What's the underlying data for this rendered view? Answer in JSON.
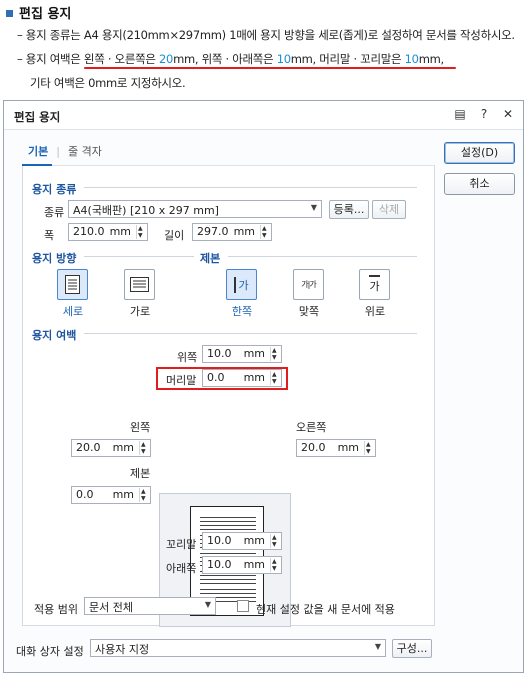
{
  "instructions": {
    "title": "편집 용지",
    "line1": "– 용지 종류는 A4 용지(210mm×297mm) 1매에 용지 방향을 세로(좁게)로 설정하여 문서를 작성하시오.",
    "line2_a": "– 용지 여백은 ",
    "line2_b": "왼쪽 · 오른쪽은 ",
    "line2_c": "20",
    "line2_d": "mm, 위쪽 · 아래쪽은 ",
    "line2_e": "10",
    "line2_f": "mm, 머리말 · 꼬리말은 ",
    "line2_g": "10",
    "line2_h": "mm,",
    "line3": "기타 여백은 0mm로 지정하시오."
  },
  "dialog": {
    "title": "편집 용지",
    "icons": [
      "help-doc-icon",
      "question-icon",
      "close-icon"
    ],
    "tabs": [
      "기본",
      "줄 격자"
    ],
    "buttons": {
      "ok": "설정(D)",
      "cancel": "취소"
    },
    "paper_type": {
      "section": "용지 종류",
      "type_label": "종류",
      "type_value": "A4(국배판) [210 x 297 mm]",
      "register": "등록...",
      "delete": "삭제",
      "width_label": "폭",
      "width_value": "210.0",
      "height_label": "길이",
      "height_value": "297.0",
      "unit": "mm"
    },
    "orientation": {
      "section": "용지 방향",
      "portrait": "세로",
      "landscape": "가로",
      "selected": "세로"
    },
    "binding": {
      "section": "제본",
      "single": "한쪽",
      "facing": "맞쪽",
      "top": "위로",
      "selected": "한쪽",
      "glyph": "가",
      "glyph_pair": "가|가"
    },
    "margins": {
      "section": "용지 여백",
      "top_label": "위쪽",
      "top_value": "10.0",
      "header_label": "머리말",
      "header_value": "0.0",
      "left_label": "왼쪽",
      "left_value": "20.0",
      "right_label": "오른쪽",
      "right_value": "20.0",
      "gutter_label": "제본",
      "gutter_value": "0.0",
      "footer_label": "꼬리말",
      "footer_value": "10.0",
      "bottom_label": "아래쪽",
      "bottom_value": "10.0",
      "unit": "mm"
    },
    "apply": {
      "label": "적용 범위",
      "value": "문서 전체",
      "checkbox_label": "현재 설정 값을 새 문서에 적용",
      "checked": false
    },
    "footer": {
      "label": "대화 상자 설정",
      "value": "사용자 지정",
      "configure": "구성..."
    }
  },
  "colors": {
    "highlight_blue": "#1a8fd8",
    "annotation_red": "#e01e1e",
    "section_blue": "#1d55a0"
  }
}
